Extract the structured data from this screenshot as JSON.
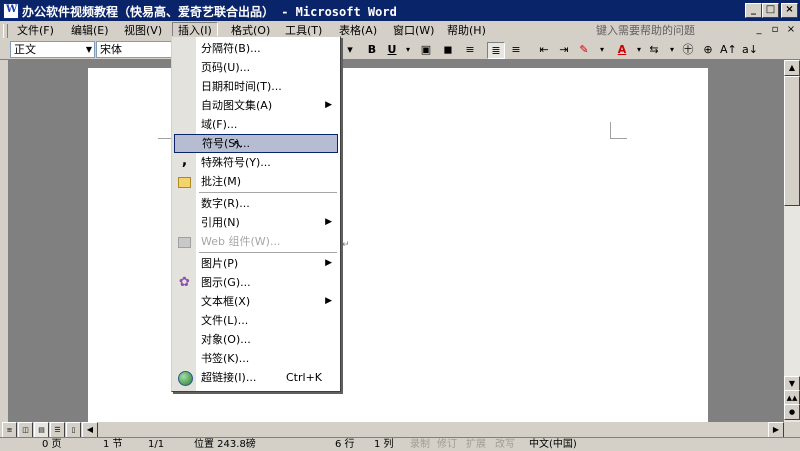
{
  "window": {
    "title": "办公软件视频教程（快易高、爱奇艺联合出品） - Microsoft Word"
  },
  "menubar": {
    "items": [
      "文件(F)",
      "编辑(E)",
      "视图(V)",
      "插入(I)",
      "格式(O)",
      "工具(T)",
      "表格(A)",
      "窗口(W)",
      "帮助(H)"
    ],
    "help_placeholder": "键入需要帮助的问题"
  },
  "toolbar": {
    "style_value": "正文",
    "font_value": "宋体",
    "bold": "B",
    "underline": "U",
    "font_color_letter": "A"
  },
  "insert_menu": {
    "items": [
      {
        "label": "分隔符(B)..."
      },
      {
        "label": "页码(U)..."
      },
      {
        "label": "日期和时间(T)..."
      },
      {
        "label": "自动图文集(A)",
        "submenu": true
      },
      {
        "label": "域(F)..."
      },
      {
        "label": "符号(S)...",
        "highlighted": true
      },
      {
        "label": "特殊符号(Y)...",
        "icon": "comma-symbol-icon"
      },
      {
        "label": "批注(M)",
        "icon": "comment-folder-icon"
      },
      {
        "label": "数字(R)..."
      },
      {
        "label": "引用(N)",
        "submenu": true
      },
      {
        "label": "Web 组件(W)...",
        "disabled": true,
        "icon": "web-component-icon"
      },
      {
        "label": "图片(P)",
        "submenu": true
      },
      {
        "label": "图示(G)...",
        "icon": "diagram-icon"
      },
      {
        "label": "文本框(X)",
        "submenu": true
      },
      {
        "label": "文件(L)..."
      },
      {
        "label": "对象(O)..."
      },
      {
        "label": "书签(K)..."
      },
      {
        "label": "超链接(I)...",
        "shortcut": "Ctrl+K",
        "icon": "hyperlink-globe-icon"
      }
    ]
  },
  "statusbar": {
    "page": "0 页",
    "section": "1 节",
    "page_of": "1/1",
    "position": "位置 243.8磅",
    "line": "6 行",
    "column": "1 列",
    "rec": "录制",
    "trk": "修订",
    "ext": "扩展",
    "ovr": "改写",
    "language": "中文(中国)"
  }
}
